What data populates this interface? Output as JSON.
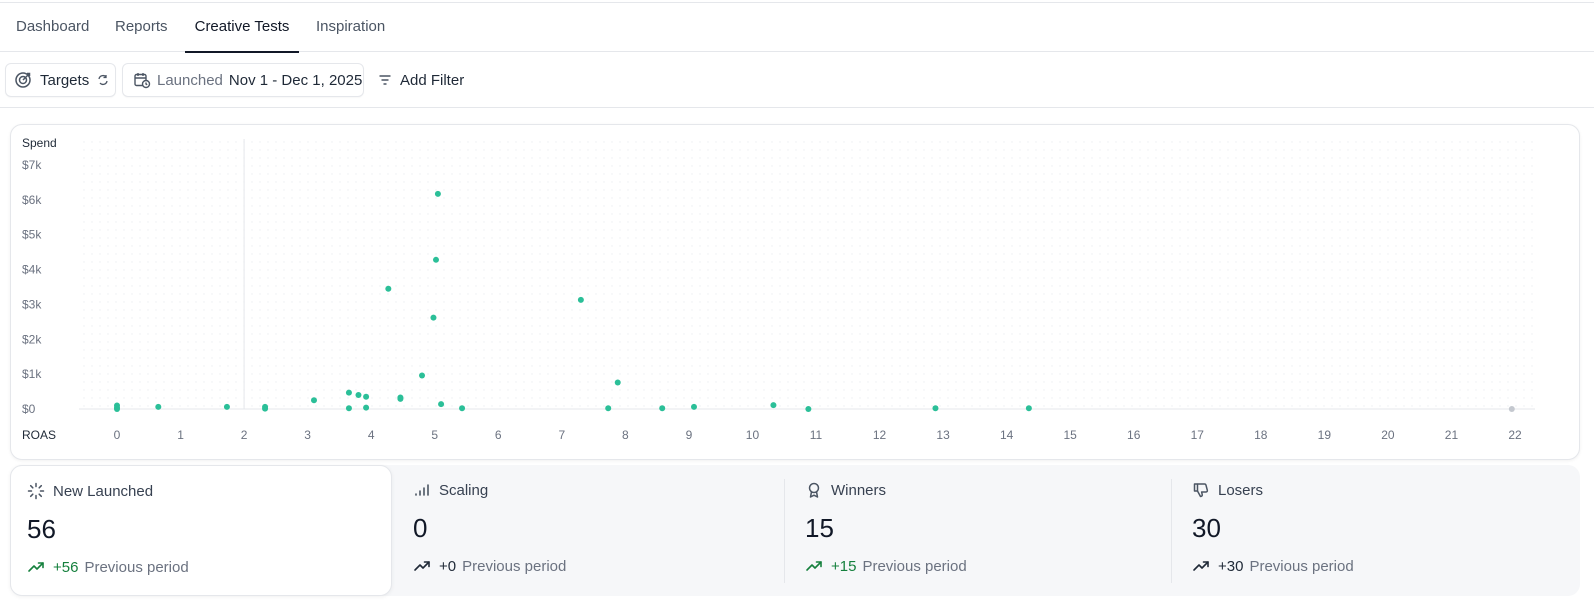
{
  "tabs": [
    {
      "label": "Dashboard"
    },
    {
      "label": "Reports"
    },
    {
      "label": "Creative Tests",
      "active": true
    },
    {
      "label": "Inspiration"
    }
  ],
  "filters": {
    "targets_label": "Targets",
    "launched_label": "Launched",
    "launched_range": "Nov 1 - Dec 1, 2025",
    "add_filter_label": "Add Filter"
  },
  "colors": {
    "point": "#2bbf98",
    "point_muted": "#c4c8cf",
    "positive": "#15803d"
  },
  "chart_data": {
    "type": "scatter",
    "xlabel": "ROAS",
    "ylabel": "Spend",
    "xlim": [
      0,
      22
    ],
    "ylim": [
      0,
      7000
    ],
    "x_ticks": [
      "0",
      "1",
      "2",
      "3",
      "4",
      "5",
      "6",
      "7",
      "8",
      "9",
      "10",
      "11",
      "12",
      "13",
      "14",
      "15",
      "16",
      "17",
      "18",
      "19",
      "20",
      "21",
      "22"
    ],
    "y_ticks": [
      "$0",
      "$1k",
      "$2k",
      "$3k",
      "$4k",
      "$5k",
      "$6k",
      "$7k"
    ],
    "reference_x": 2,
    "points": [
      {
        "x": 0,
        "y": 100
      },
      {
        "x": 0,
        "y": 40
      },
      {
        "x": 0,
        "y": 0
      },
      {
        "x": 0.65,
        "y": 60
      },
      {
        "x": 1.73,
        "y": 60
      },
      {
        "x": 2.33,
        "y": 60
      },
      {
        "x": 2.33,
        "y": 10
      },
      {
        "x": 3.1,
        "y": 250
      },
      {
        "x": 3.65,
        "y": 470
      },
      {
        "x": 3.65,
        "y": 20
      },
      {
        "x": 3.8,
        "y": 400
      },
      {
        "x": 3.92,
        "y": 350
      },
      {
        "x": 3.92,
        "y": 40
      },
      {
        "x": 4.27,
        "y": 3450
      },
      {
        "x": 4.46,
        "y": 330
      },
      {
        "x": 4.46,
        "y": 290
      },
      {
        "x": 4.8,
        "y": 960
      },
      {
        "x": 4.98,
        "y": 2620
      },
      {
        "x": 5.02,
        "y": 4280
      },
      {
        "x": 5.05,
        "y": 6170
      },
      {
        "x": 5.1,
        "y": 140
      },
      {
        "x": 5.43,
        "y": 20
      },
      {
        "x": 7.3,
        "y": 3130
      },
      {
        "x": 7.73,
        "y": 20
      },
      {
        "x": 7.88,
        "y": 760
      },
      {
        "x": 8.58,
        "y": 20
      },
      {
        "x": 9.08,
        "y": 60
      },
      {
        "x": 10.33,
        "y": 110
      },
      {
        "x": 10.88,
        "y": 0
      },
      {
        "x": 12.88,
        "y": 20
      },
      {
        "x": 14.35,
        "y": 20
      },
      {
        "x": 21.95,
        "y": 0,
        "muted": true
      }
    ]
  },
  "stats": [
    {
      "label": "New Launched",
      "icon": "loader-icon",
      "value": "56",
      "delta": "+56",
      "previous": "Previous period",
      "positive": true
    },
    {
      "label": "Scaling",
      "icon": "signal-bars-icon",
      "value": "0",
      "delta": "+0",
      "previous": "Previous period",
      "positive": false
    },
    {
      "label": "Winners",
      "icon": "award-icon",
      "value": "15",
      "delta": "+15",
      "previous": "Previous period",
      "positive": true
    },
    {
      "label": "Losers",
      "icon": "thumbs-down-icon",
      "value": "30",
      "delta": "+30",
      "previous": "Previous period",
      "positive": false
    }
  ]
}
